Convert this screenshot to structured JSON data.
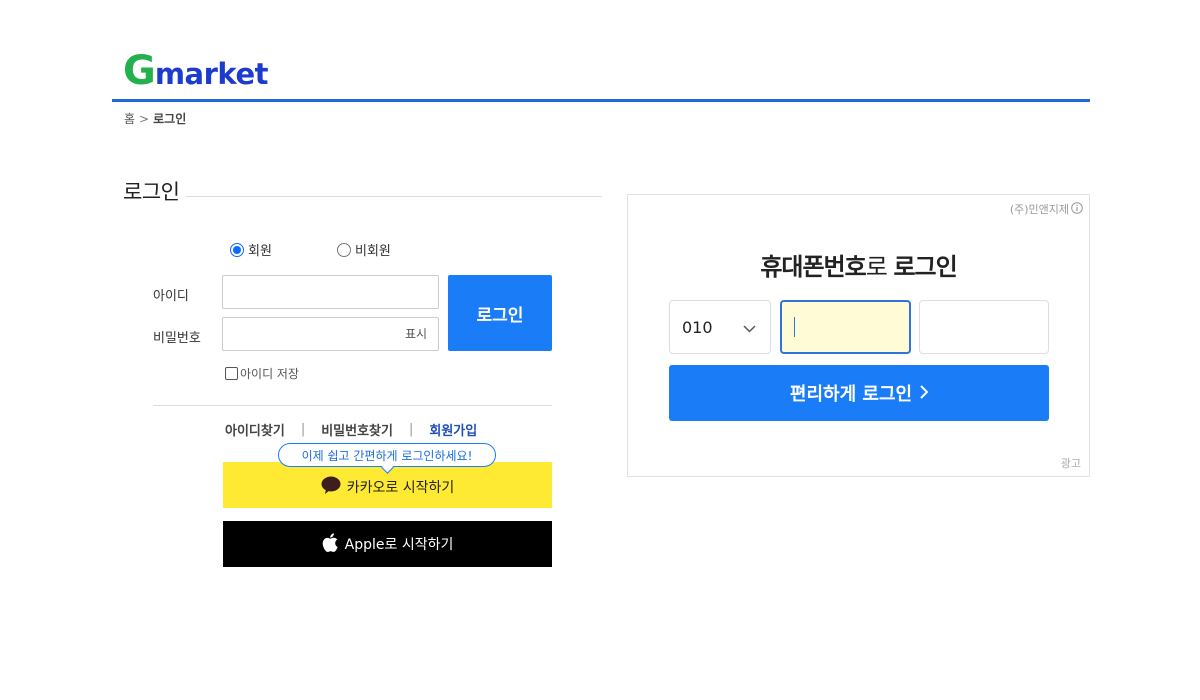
{
  "header": {
    "logo_g": "G",
    "logo_rest": "market",
    "brand_green": "#22b14c",
    "brand_blue": "#1d3ccf"
  },
  "breadcrumb": {
    "home": "홈",
    "separator": ">",
    "current": "로그인"
  },
  "login": {
    "title": "로그인",
    "member_options": [
      {
        "label": "회원",
        "selected": true
      },
      {
        "label": "비회원",
        "selected": false
      }
    ],
    "id_label": "아이디",
    "id_value": "",
    "password_label": "비밀번호",
    "password_value": "",
    "show_password": "표시",
    "login_button": "로그인",
    "save_id_label": "아이디 저장",
    "save_id_checked": false,
    "links": {
      "find_id": "아이디찾기",
      "separator": "|",
      "find_password": "비밀번호찾기",
      "signup": "회원가입"
    },
    "tooltip": "이제 쉽고 간편하게 로그인하세요!",
    "kakao_button": "카카오로 시작하기",
    "apple_button": "Apple로 시작하기",
    "kakao_icon": "speech-bubble-icon",
    "apple_icon": "apple-icon",
    "accent_color": "#1a7cf7"
  },
  "ad": {
    "advertiser": "(주)민앤지제",
    "info_icon": "info-icon",
    "headline_bold_1": "휴대폰번호",
    "headline_normal": "로 ",
    "headline_bold_2": "로그인",
    "prefix_value": "010",
    "prefix_icon": "chevron-down-icon",
    "middle_value": "",
    "last_value": "",
    "easy_login_button": "편리하게 로그인",
    "button_icon": "chevron-right-icon",
    "ad_label": "광고"
  }
}
